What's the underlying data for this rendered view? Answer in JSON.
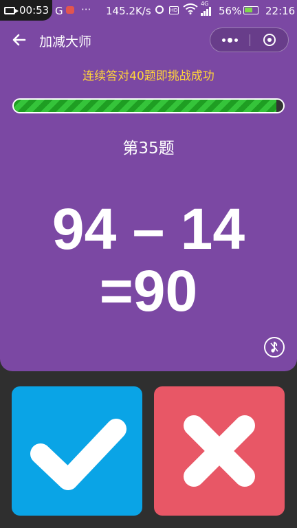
{
  "status_bar": {
    "record_time": "00:53",
    "network_letter": "G",
    "overflow_dots": "···",
    "net_speed": "145.2K/s",
    "network_type": "4G",
    "battery_percent": "56%",
    "clock": "22:16",
    "hd_label": "HD"
  },
  "header": {
    "back_icon": "arrow-left-icon",
    "title": "加减大师"
  },
  "game": {
    "challenge_text": "连续答对40题即挑战成功",
    "progress_fraction": 0.975,
    "question_label": "第35题",
    "expression": "94 – 14",
    "answer": "=90"
  },
  "buttons": {
    "correct_icon": "checkmark-icon",
    "wrong_icon": "cross-icon",
    "correct_color": "#0aa4e6",
    "wrong_color": "#e85766"
  },
  "colors": {
    "panel": "#7b48a3",
    "challenge_text": "#ffd43a",
    "progress": "#2db532"
  }
}
